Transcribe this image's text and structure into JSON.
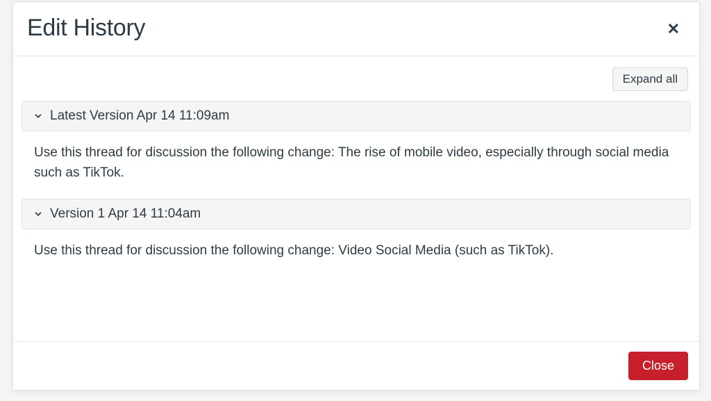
{
  "modal": {
    "title": "Edit History",
    "expand_label": "Expand all",
    "close_button_label": "Close"
  },
  "versions": [
    {
      "header": "Latest Version Apr 14 11:09am",
      "content": "Use this thread for discussion the following change: The rise of mobile video, especially through social media such as TikTok."
    },
    {
      "header": "Version 1 Apr 14 11:04am",
      "content": "Use this thread for discussion the following change: Video Social Media (such as TikTok)."
    }
  ]
}
